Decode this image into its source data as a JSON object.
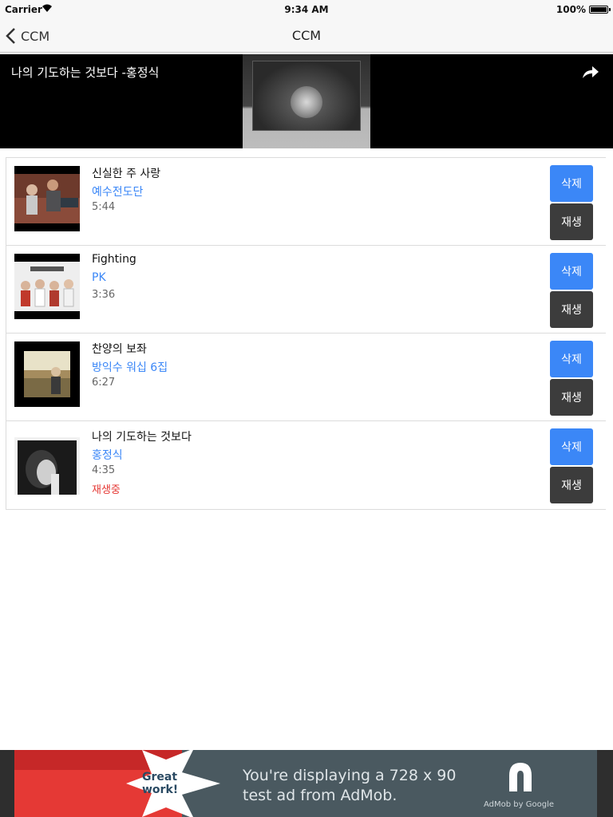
{
  "status_bar": {
    "carrier": "Carrier",
    "time": "9:34 AM",
    "battery": "100%"
  },
  "nav": {
    "back_label": "CCM",
    "title": "CCM"
  },
  "player": {
    "title": "나의 기도하는 것보다 -홍정식"
  },
  "songs": [
    {
      "title": "신실한 주 사랑",
      "artist": "예수전도단",
      "duration": "5:44",
      "status": "",
      "delete_label": "삭제",
      "play_label": "재생"
    },
    {
      "title": "Fighting",
      "artist": "PK",
      "duration": "3:36",
      "status": "",
      "delete_label": "삭제",
      "play_label": "재생"
    },
    {
      "title": "찬양의 보좌",
      "artist": "방익수 워십 6집",
      "duration": "6:27",
      "status": "",
      "delete_label": "삭제",
      "play_label": "재생"
    },
    {
      "title": "나의 기도하는 것보다",
      "artist": "홍정식",
      "duration": "4:35",
      "status": "재생중",
      "delete_label": "삭제",
      "play_label": "재생"
    }
  ],
  "ad": {
    "badge_line1": "Great",
    "badge_line2": "work!",
    "line1": "You're displaying a 728 x 90",
    "line2": "test ad from AdMob.",
    "brand": "AdMob by Google"
  },
  "colors": {
    "accent": "#3b87f7",
    "play_button": "#3c3c3c",
    "playing_status": "#e53935"
  }
}
